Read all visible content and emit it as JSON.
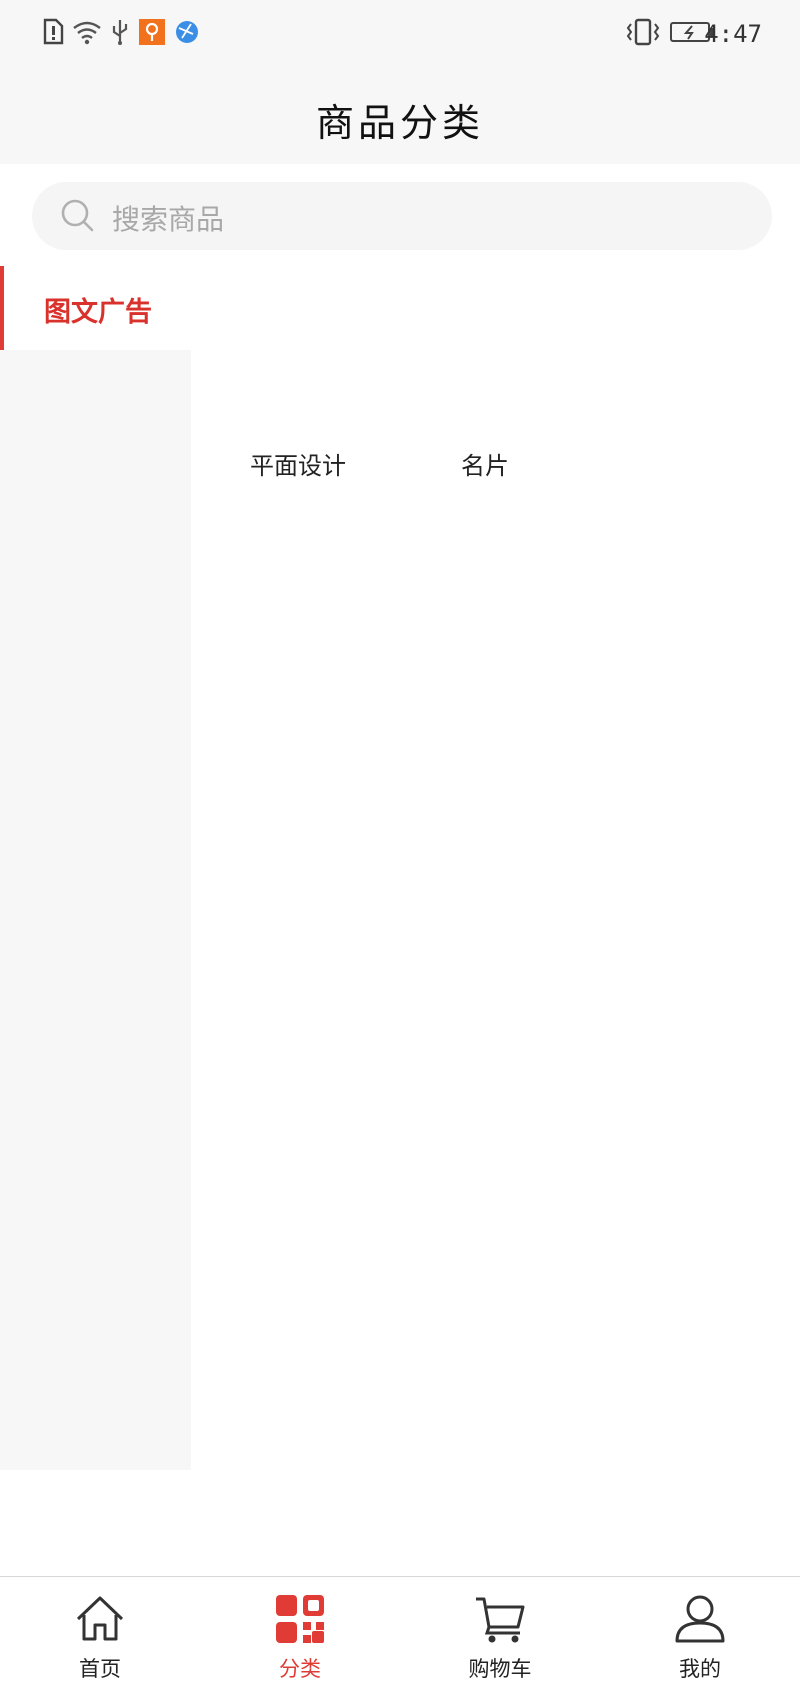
{
  "status_bar": {
    "time": "4:47",
    "left_icons": [
      "sim-alert-icon",
      "wifi-icon",
      "usb-icon",
      "app-notification-icon",
      "browser-icon"
    ],
    "right_icons": [
      "vibrate-icon",
      "battery-charging-icon"
    ]
  },
  "header": {
    "title": "商品分类"
  },
  "search": {
    "placeholder": "搜索商品",
    "icon": "search-icon"
  },
  "sidebar": {
    "items": [
      {
        "label": "图文广告",
        "active": true
      }
    ],
    "accent_color": "#e03b35"
  },
  "content": {
    "subcategories": [
      {
        "label": "平面设计"
      },
      {
        "label": "名片"
      }
    ]
  },
  "tab_bar": {
    "active_color": "#e03b35",
    "items": [
      {
        "label": "首页",
        "icon": "home-icon",
        "active": false
      },
      {
        "label": "分类",
        "icon": "category-icon",
        "active": true
      },
      {
        "label": "购物车",
        "icon": "cart-icon",
        "active": false
      },
      {
        "label": "我的",
        "icon": "profile-icon",
        "active": false
      }
    ]
  }
}
